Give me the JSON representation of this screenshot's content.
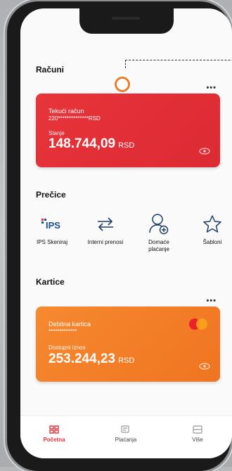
{
  "accounts": {
    "title": "Računi",
    "more": "•••",
    "card": {
      "name": "Tekući račun",
      "number": "220**************RSD",
      "balance_label": "Stanje",
      "amount": "148.744,09",
      "currency": "RSD",
      "color": "#e2303a"
    }
  },
  "shortcuts": {
    "title": "Prečice",
    "items": [
      {
        "label": "IPS Skeniraj",
        "icon": "ips-logo-icon"
      },
      {
        "label": "Interni prenosi",
        "icon": "transfer-arrows-icon"
      },
      {
        "label": "Domaće plaćanje",
        "icon": "user-add-icon"
      },
      {
        "label": "Šabloni",
        "icon": "star-icon"
      }
    ]
  },
  "cards": {
    "title": "Kartice",
    "more": "•••",
    "card": {
      "name": "Debitna kartica",
      "number": "*************",
      "balance_label": "Dostupni iznos",
      "amount": "253.244,23",
      "currency": "RSD",
      "color": "#f37a27"
    }
  },
  "ips_logo_text": "IPS",
  "tabbar": {
    "items": [
      {
        "label": "Početna",
        "active": true,
        "icon": "home-grid-icon"
      },
      {
        "label": "Plaćanja",
        "active": false,
        "icon": "payment-card-icon"
      },
      {
        "label": "Više",
        "active": false,
        "icon": "more-menu-icon"
      }
    ],
    "active_color": "#e2303a"
  }
}
